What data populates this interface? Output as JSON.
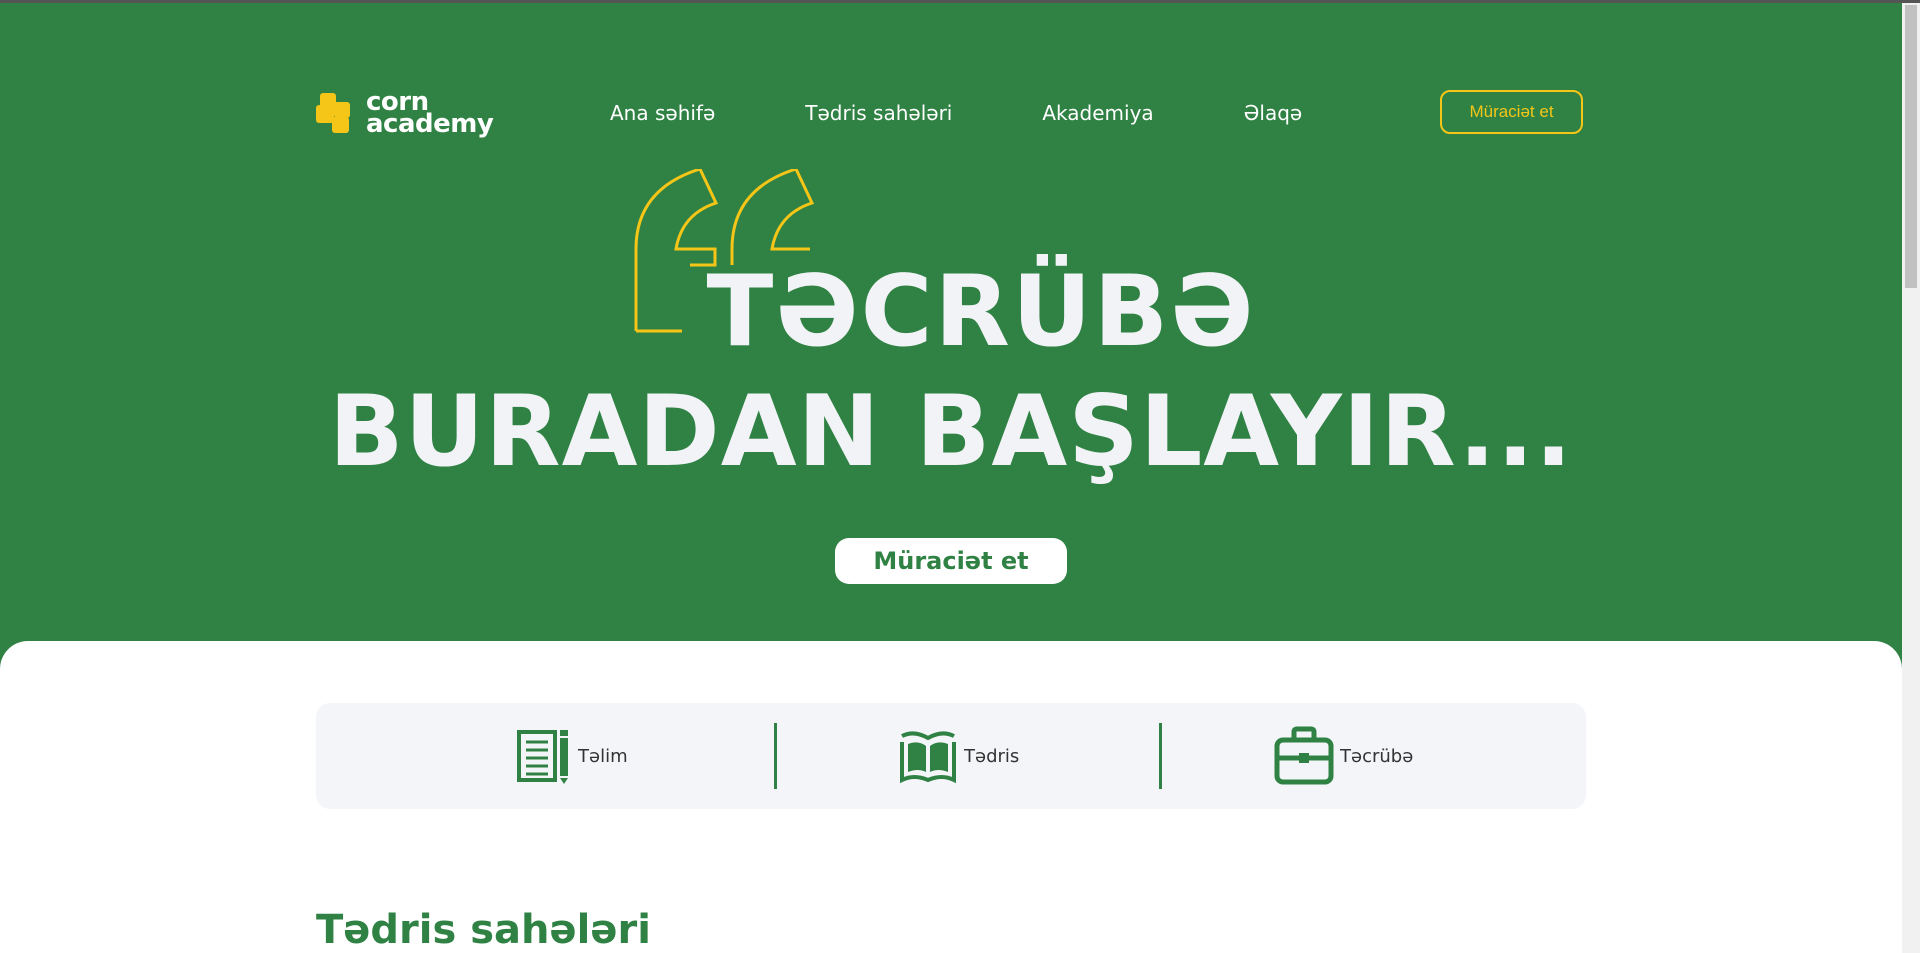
{
  "header": {
    "logo_line1": "corn",
    "logo_line2": "academy",
    "nav": [
      {
        "label": "Ana səhifə"
      },
      {
        "label": "Tədris sahələri"
      },
      {
        "label": "Akademiya"
      },
      {
        "label": "Əlaqə"
      }
    ],
    "cta_label": "Müraciət et"
  },
  "hero": {
    "line1": "TƏCRÜBƏ",
    "line2": "BURADAN BAŞLAYIR...",
    "button_label": "Müraciət et",
    "quote_icon": "quote-icon"
  },
  "features": [
    {
      "label": "Təlim",
      "icon": "notepad-pencil-icon"
    },
    {
      "label": "Tədris",
      "icon": "open-book-icon"
    },
    {
      "label": "Təcrübə",
      "icon": "briefcase-icon"
    }
  ],
  "section": {
    "title": "Tədris sahələri"
  },
  "colors": {
    "brand_green": "#2f8243",
    "accent_yellow": "#f5c518",
    "panel_bg": "#f4f5f9"
  }
}
